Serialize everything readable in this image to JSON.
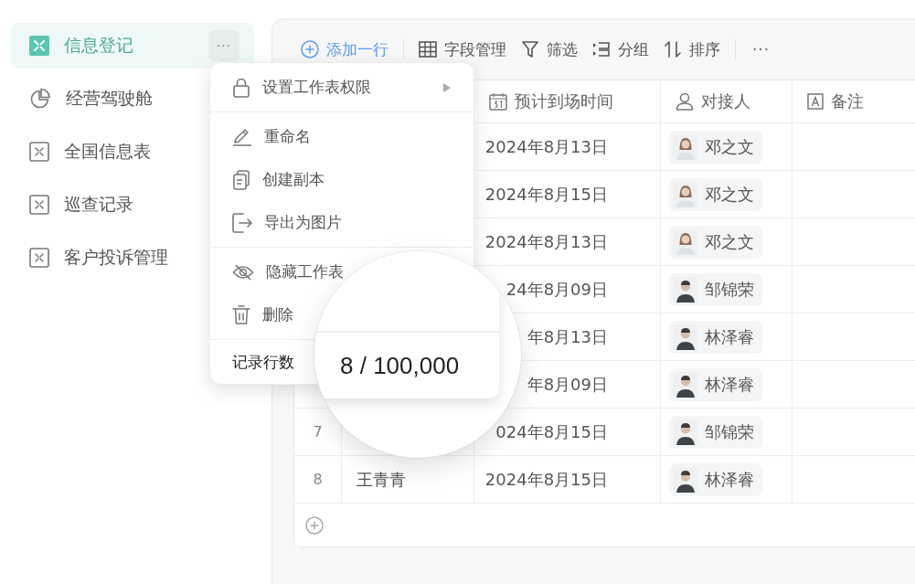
{
  "sidebar": {
    "items": [
      {
        "label": "信息登记",
        "kind": "sheet",
        "selected": true
      },
      {
        "label": "经营驾驶舱",
        "kind": "dashboard",
        "selected": false
      },
      {
        "label": "全国信息表",
        "kind": "sheet",
        "selected": false
      },
      {
        "label": "巡查记录",
        "kind": "sheet",
        "selected": false
      },
      {
        "label": "客户投诉管理",
        "kind": "sheet",
        "selected": false
      }
    ],
    "more_button": "···"
  },
  "toolbar": {
    "items": [
      {
        "label": "添加一行",
        "kind": "add"
      },
      {
        "label": "字段管理",
        "kind": "fields"
      },
      {
        "label": "筛选",
        "kind": "filter"
      },
      {
        "label": "分组",
        "kind": "group"
      },
      {
        "label": "排序",
        "kind": "sort"
      }
    ],
    "more_button": "···"
  },
  "table": {
    "columns": [
      {
        "label": "预计到场时间",
        "kind": "date"
      },
      {
        "label": "对接人",
        "kind": "person"
      },
      {
        "label": "备注",
        "kind": "text"
      }
    ],
    "rows": [
      {
        "date": "2024年8月13日",
        "contact": "邓之文",
        "kind": "woman"
      },
      {
        "date": "2024年8月15日",
        "contact": "邓之文",
        "kind": "woman"
      },
      {
        "date": "2024年8月13日",
        "contact": "邓之文",
        "kind": "woman"
      },
      {
        "date": "24年8月09日",
        "contact": "邹锦荣",
        "kind": "man"
      },
      {
        "date": "年8月13日",
        "contact": "林泽睿",
        "kind": "man"
      },
      {
        "date": "年8月09日",
        "contact": "林泽睿",
        "kind": "man"
      },
      {
        "number": "7",
        "date": "024年8月15日",
        "contact": "邹锦荣",
        "kind": "man"
      },
      {
        "number": "8",
        "name": "王青青",
        "date": "2024年8月15日",
        "contact": "林泽睿",
        "kind": "man"
      }
    ]
  },
  "menu": {
    "sections": [
      {
        "items": [
          {
            "label": "设置工作表权限",
            "kind": "lock",
            "submenu": true
          }
        ]
      },
      {
        "items": [
          {
            "label": "重命名",
            "kind": "rename",
            "submenu": false
          },
          {
            "label": "创建副本",
            "kind": "copy",
            "submenu": false
          },
          {
            "label": "导出为图片",
            "kind": "export",
            "submenu": false
          }
        ]
      },
      {
        "items": [
          {
            "label": "隐藏工作表",
            "kind": "hide",
            "submenu": false
          },
          {
            "label": "删除",
            "kind": "delete",
            "submenu": false
          }
        ]
      }
    ],
    "footer_label": "记录行数"
  },
  "magnifier": {
    "count": "8 / 100,000"
  }
}
